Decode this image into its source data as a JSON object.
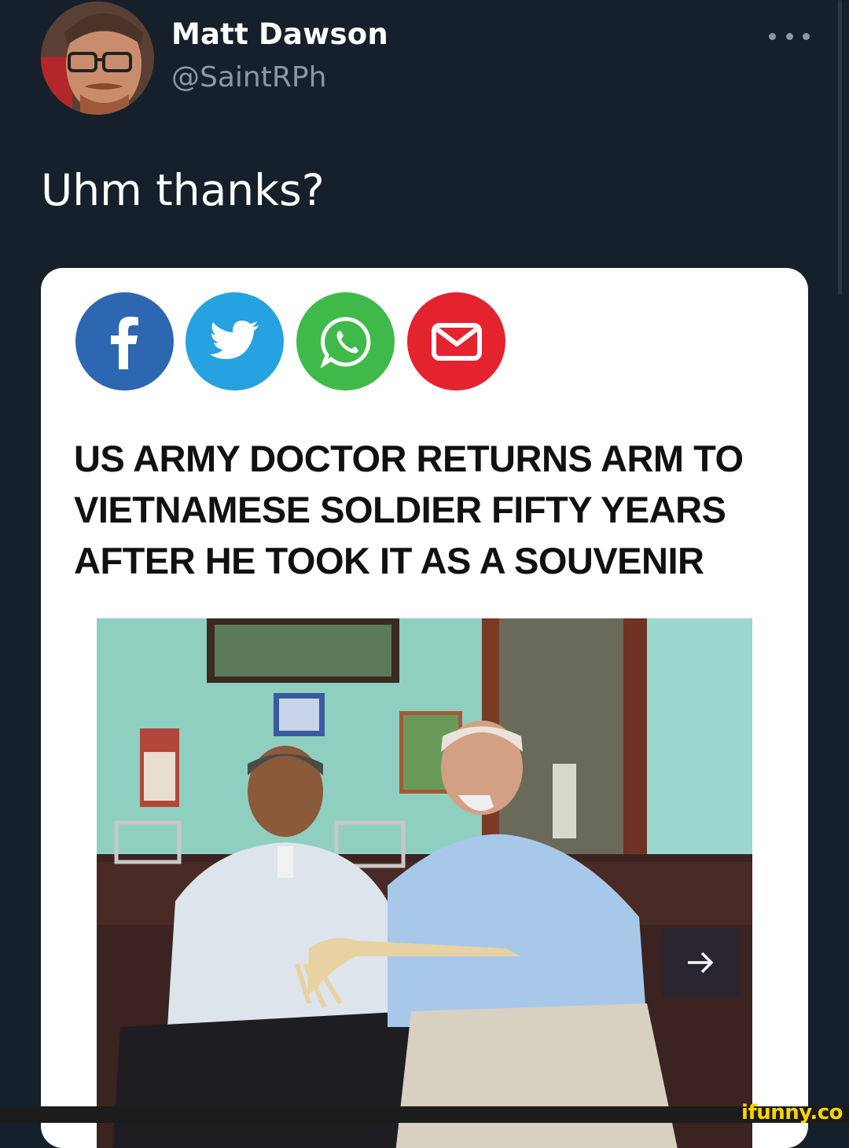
{
  "tweet": {
    "display_name": "Matt Dawson",
    "handle": "@SaintRPh",
    "text": "Uhm thanks?"
  },
  "share_buttons": [
    {
      "name": "facebook",
      "color": "#2d67b2",
      "icon": "facebook-icon"
    },
    {
      "name": "twitter",
      "color": "#26a2e0",
      "icon": "twitter-icon"
    },
    {
      "name": "whatsapp",
      "color": "#3fba4a",
      "icon": "whatsapp-icon"
    },
    {
      "name": "email",
      "color": "#e4232f",
      "icon": "mail-icon"
    }
  ],
  "headline": {
    "line1": "US ARMY DOCTOR RETURNS ARM TO",
    "line2": "VIETNAMESE SOLDIER FIFTY YEARS",
    "line3": "AFTER HE TOOK IT AS A SOUVENIR"
  },
  "watermark": "ifunny.co",
  "colors": {
    "background": "#15202b",
    "secondary_text": "#8899a6",
    "watermark": "#ffd400"
  }
}
